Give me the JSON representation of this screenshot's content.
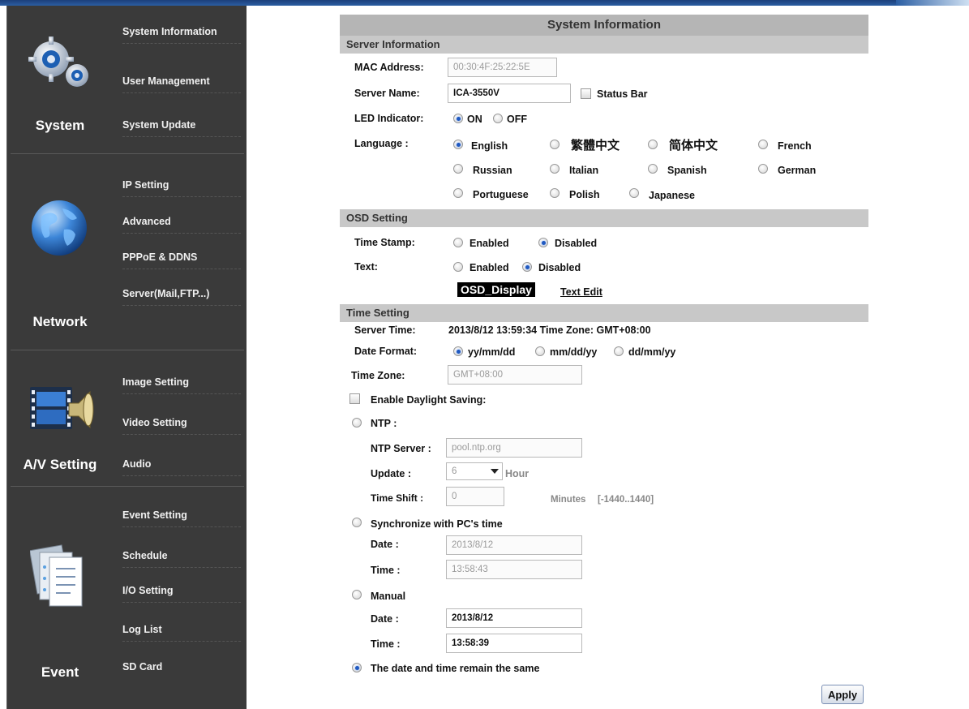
{
  "sidebar": {
    "sections": [
      {
        "label": "System",
        "icon": "gears-icon",
        "items": [
          "System Information",
          "User Management",
          "System Update"
        ]
      },
      {
        "label": "Network",
        "icon": "globe-icon",
        "items": [
          "IP Setting",
          "Advanced",
          "PPPoE & DDNS",
          "Server(Mail,FTP...)"
        ]
      },
      {
        "label": "A/V Setting",
        "icon": "film-speaker-icon",
        "items": [
          "Image Setting",
          "Video Setting",
          "Audio"
        ]
      },
      {
        "label": "Event",
        "icon": "documents-icon",
        "items": [
          "Event Setting",
          "Schedule",
          "I/O Setting",
          "Log List",
          "SD Card"
        ]
      }
    ]
  },
  "page": {
    "title": "System Information"
  },
  "server_info": {
    "heading": "Server Information",
    "mac_label": "MAC Address:",
    "mac_value": "00:30:4F:25:22:5E",
    "name_label": "Server Name:",
    "name_value": "ICA-3550V",
    "status_bar_label": "Status Bar",
    "led_label": "LED Indicator:",
    "led_on": "ON",
    "led_off": "OFF",
    "language_label": "Language :",
    "languages": [
      "English",
      "繁體中文",
      "简体中文",
      "French",
      "Russian",
      "Italian",
      "Spanish",
      "German",
      "Portuguese",
      "Polish",
      "Japanese"
    ]
  },
  "osd": {
    "heading": "OSD Setting",
    "timestamp_label": "Time Stamp:",
    "text_label": "Text:",
    "enabled": "Enabled",
    "disabled": "Disabled",
    "display_text": "OSD_Display",
    "text_edit": "Text Edit"
  },
  "time": {
    "heading": "Time Setting",
    "server_time_label": "Server Time:",
    "server_time_value": "2013/8/12 13:59:34 Time Zone: GMT+08:00",
    "date_format_label": "Date Format:",
    "formats": [
      "yy/mm/dd",
      "mm/dd/yy",
      "dd/mm/yy"
    ],
    "timezone_label": "Time Zone:",
    "timezone_value": "GMT+08:00",
    "daylight_label": "Enable Daylight Saving:",
    "ntp_label": "NTP :",
    "ntp_server_label": "NTP Server :",
    "ntp_server_value": "pool.ntp.org",
    "update_label": "Update :",
    "update_value": "6",
    "update_unit": "Hour",
    "shift_label": "Time Shift :",
    "shift_value": "0",
    "shift_unit": "Minutes",
    "shift_range": "[-1440..1440]",
    "sync_label": "Synchronize with PC's time",
    "sync_date_label": "Date :",
    "sync_date_value": "2013/8/12",
    "sync_time_label": "Time :",
    "sync_time_value": "13:58:43",
    "manual_label": "Manual",
    "manual_date_label": "Date :",
    "manual_date_value": "2013/8/12",
    "manual_time_label": "Time :",
    "manual_time_value": "13:58:39",
    "remain_label": "The date and time remain the same"
  },
  "apply_label": "Apply"
}
